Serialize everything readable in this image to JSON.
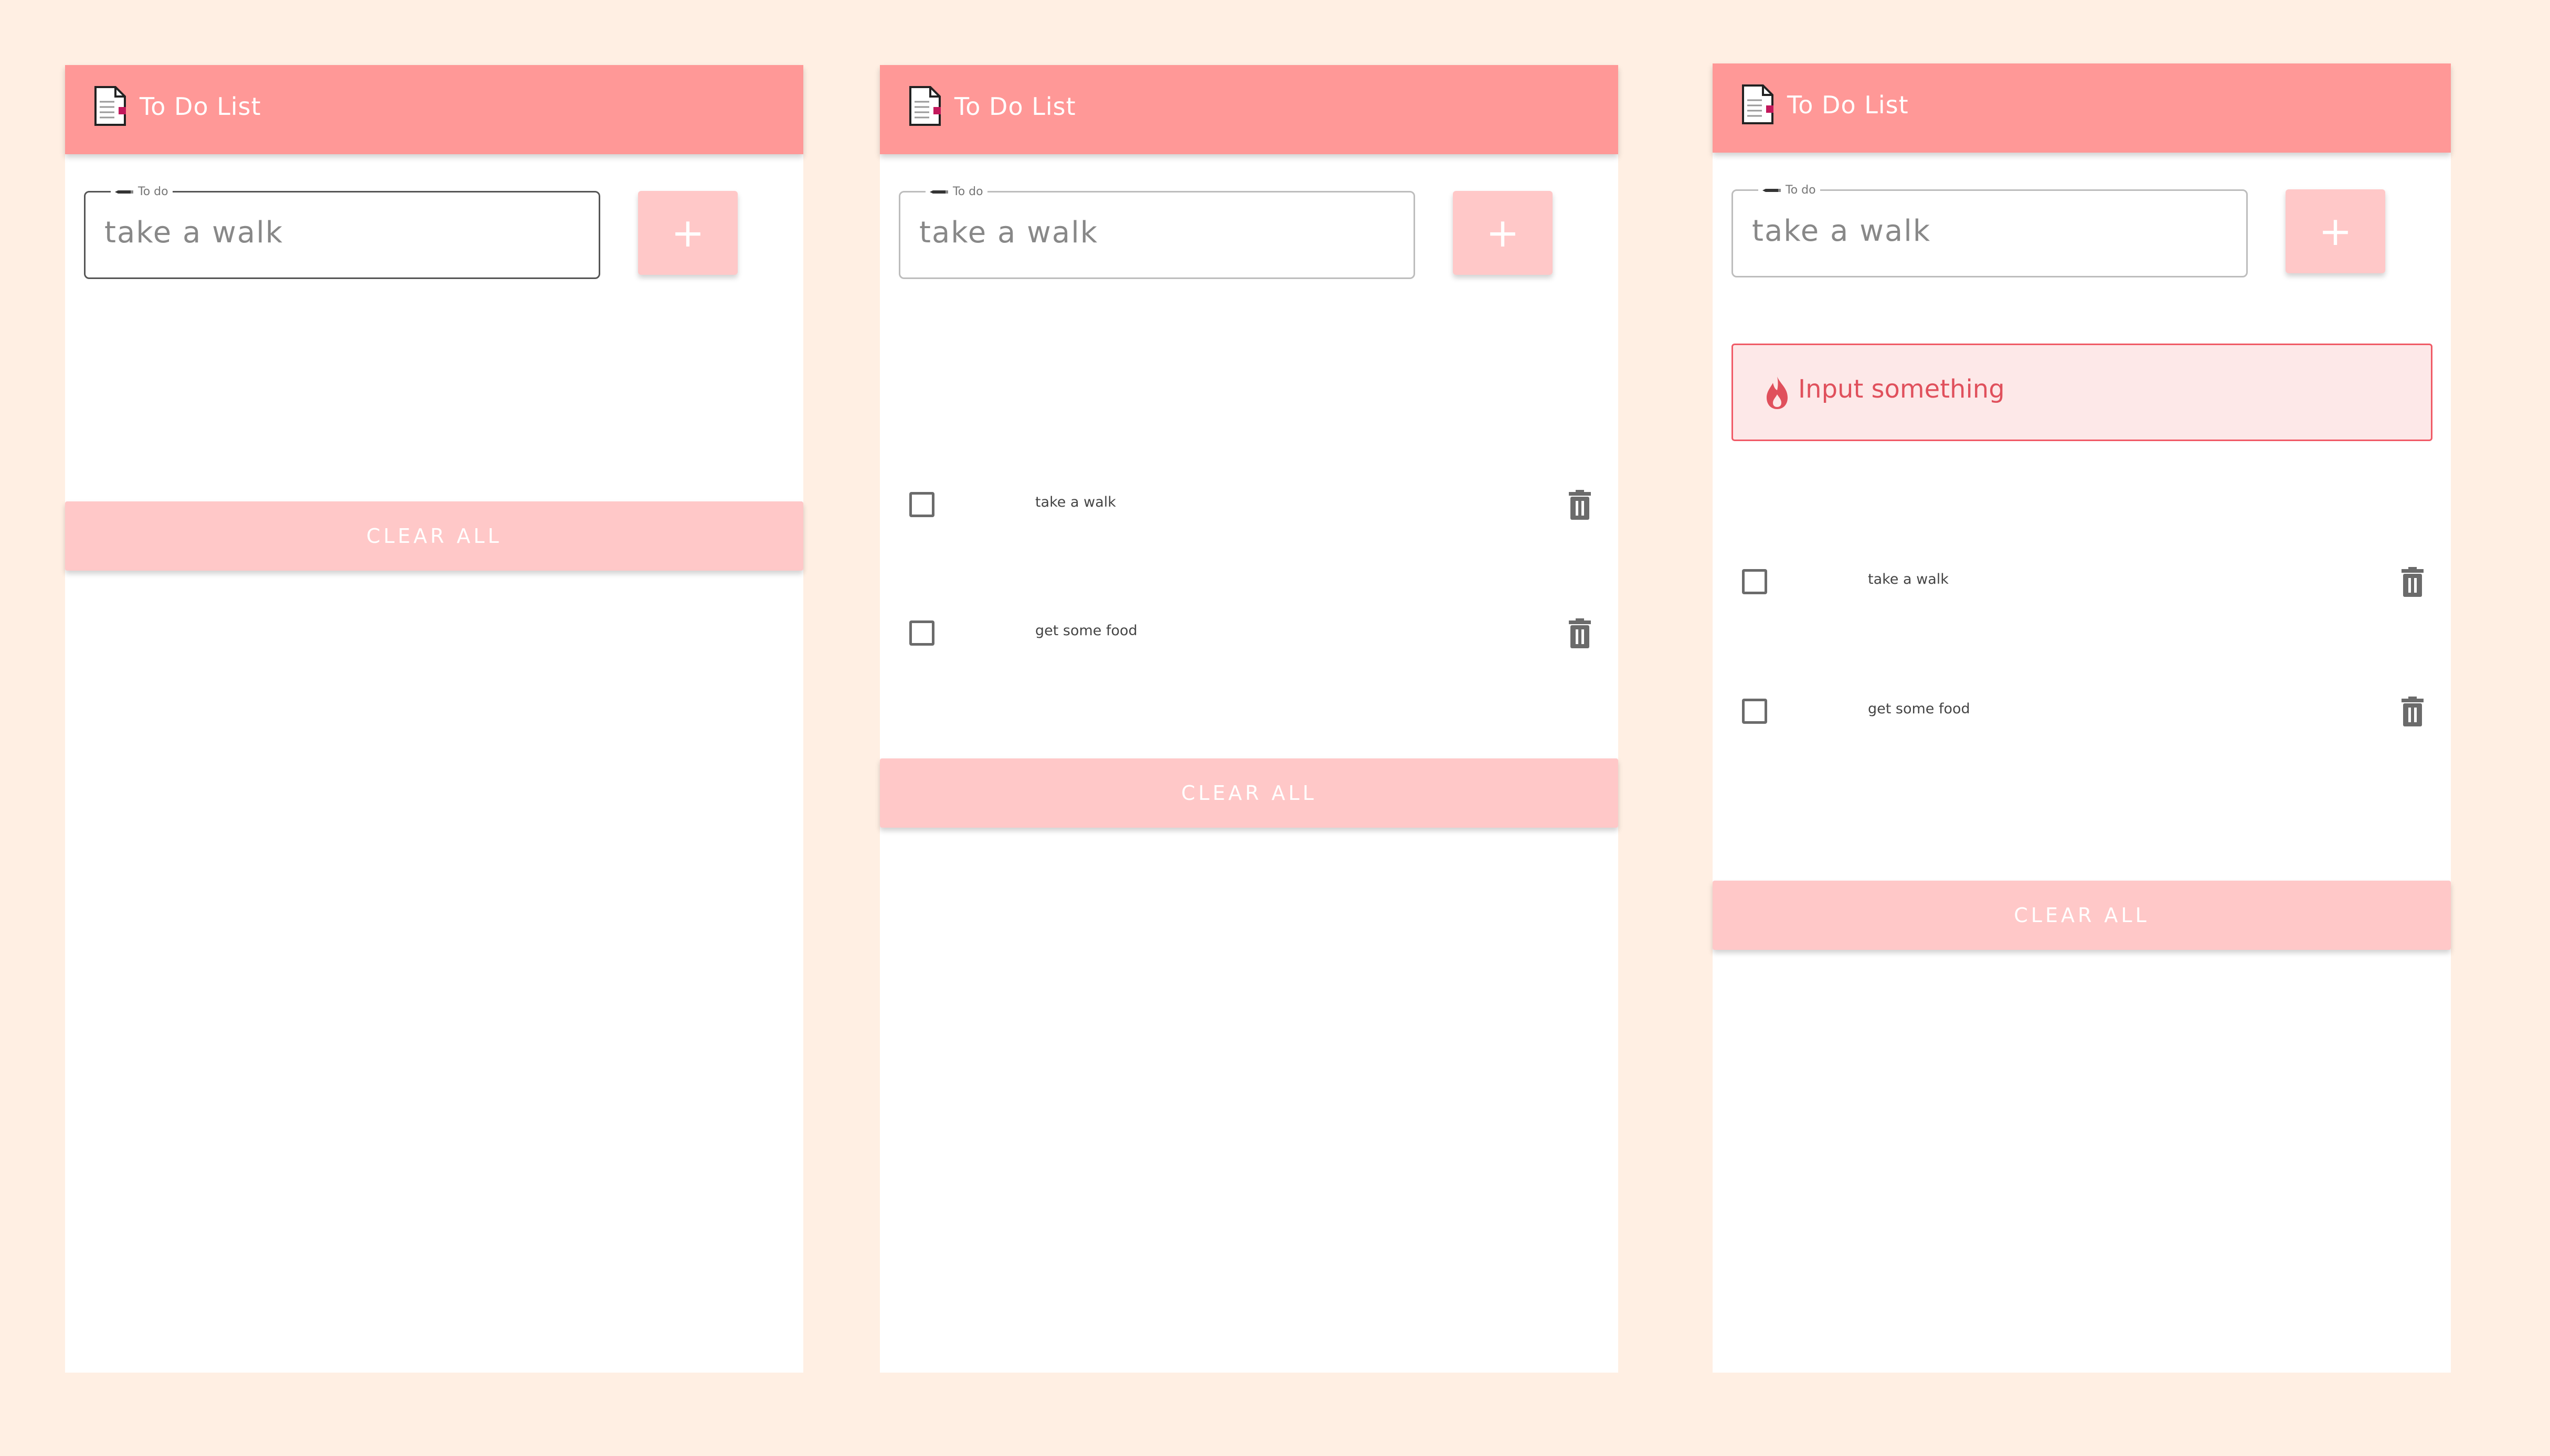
{
  "colors": {
    "background": "#FFEFE3",
    "header": "#FF9897",
    "button": "#FFC8C8",
    "alert_border": "#F05A66",
    "alert_bg": "#FDE8E8",
    "alert_text": "#E0505C"
  },
  "app": {
    "title": "To Do List",
    "title_icon": "document-icon"
  },
  "input": {
    "label": "To do",
    "value": "take a walk"
  },
  "add_button": {
    "label": "+"
  },
  "clear_button": {
    "label": "CLEAR ALL"
  },
  "alert": {
    "icon": "fire-icon",
    "message": "Input something"
  },
  "todos": [
    {
      "text": "take a walk",
      "checked": false
    },
    {
      "text": "get some food",
      "checked": false
    }
  ]
}
